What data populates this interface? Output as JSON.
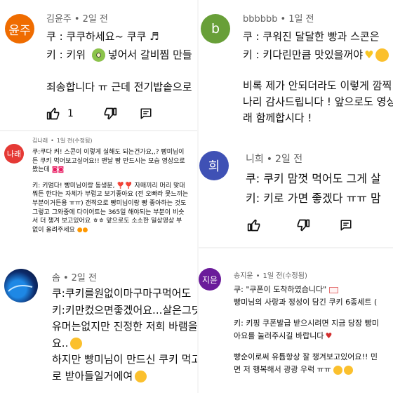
{
  "comment1": {
    "avatar_text": "윤주",
    "author": "김윤주",
    "time": "2일 전",
    "line1": "쿠 : 쿠쿠하세요~ 쿠쿠 ♬",
    "line2a": "키 : 키위",
    "line2b": "넣어서 갈비찜 만들",
    "line3": "죄송합니다 ㅠ 근데 전기밥솥으로",
    "likes": "1",
    "color": "#ef6c00"
  },
  "comment2": {
    "avatar_text": "b",
    "author": "bbbbbb",
    "time": "1일 전",
    "line1": "쿠 : 쿠워진 달달한 빵과 스콘은",
    "line2": "키 : 키다린만큼 맛있을꺼야",
    "line3": "비록 제가 안되더라도 이렇게 깜찍",
    "line4": "나리 감사드립니다 ! 앞으로도 영상",
    "line5": "래 함께합시다 !",
    "color": "#689f38"
  },
  "comment3": {
    "avatar_text": "나래",
    "author": "김나래",
    "time": "1일 전(수정됨)",
    "lines": [
      "쿠:쿠다 커! 스콘이 이렇게 실해도 되는건가요,,? 빵미님이",
      "든 쿠키 먹어보고싶어요!! 맨날 빵 만드시는 모습 영상으로",
      "봤는데",
      "키: 키멈다! 빵미님이랑 동생분, ❣️❣️ 자매끼리 머리 맞대",
      "뭐든 한다는 자체가 부럽고 보기좋아요 (전 오빠라 못느끼는",
      "부분이거든용 ㅠㅠ) 갠적으로 빵미님이랑 빵 좋아하는 것도",
      "그렇고 그와중에 다이어트는 365일 해야되는 부분이 비슷",
      "서 더 챙겨 보고있어요 ㅎㅎ 앞으로도 소소한 일상영상 부",
      "없이 올려주세요"
    ],
    "color": "#e53935"
  },
  "comment4": {
    "avatar_text": "희",
    "author": "니희",
    "time": "2일 전",
    "line1": "쿠: 쿠키 맘껏 먹어도 그게 살",
    "line2": "키: 키로 가면 좋겠다 ㅠㅠ 맘",
    "color": "#3f51b5"
  },
  "comment5": {
    "author": "솜",
    "time": "2일 전",
    "lines": [
      "쿠:쿠키를원없이마구마구먹어도",
      "키:키만컸으면좋겠어요...살은그딧",
      "유머는없지만 진정한 저희 바램을",
      "요..",
      "하지만 빵미님이 만드신 쿠키 먹고",
      "로 받아들일거에여"
    ]
  },
  "comment6": {
    "avatar_text": "지윤",
    "author": "송지윤",
    "time": "1일 전(수정됨)",
    "lines": [
      "쿠: \"쿠폰이 도착하였습니다\"",
      "빵미님의 사랑과 정성이 담긴 쿠키 6종세트 (",
      "키: 키핑 쿠폰발급 받으시려면 지금 당장 빵미",
      "아요를 눌러주시길 바랍니다",
      "빵순이로써 유튭항상 잘 챙겨보고있어요!! 민",
      "면 저 행복해서 광광 우럭 ㅠㅠ"
    ],
    "color": "#6a1b9a"
  },
  "icons": [
    "thumb-up-icon",
    "thumb-down-icon",
    "reply-icon",
    "kiwi-emoji",
    "heart-emoji",
    "mail-icon"
  ]
}
